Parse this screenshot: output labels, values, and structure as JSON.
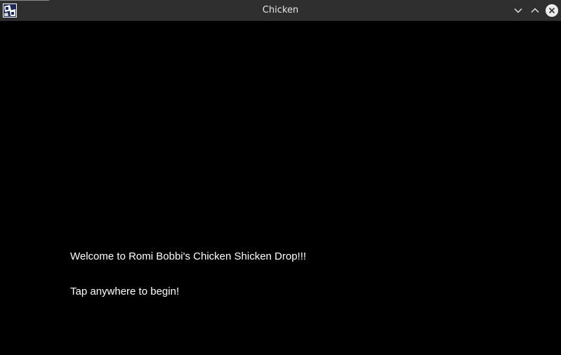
{
  "window": {
    "title": "Chicken",
    "icons": {
      "app": "app-icon",
      "minimize": "chevron-down-icon",
      "maximize": "chevron-up-icon",
      "close": "close-icon"
    },
    "colors": {
      "titlebar": "#2f2f2f",
      "title_text": "#e6e6e6",
      "background": "#000000",
      "text": "#ffffff"
    }
  },
  "game": {
    "welcome_text": "Welcome to Romi Bobbi's Chicken Shicken Drop!!!",
    "instruction_text": "Tap anywhere to begin!"
  }
}
